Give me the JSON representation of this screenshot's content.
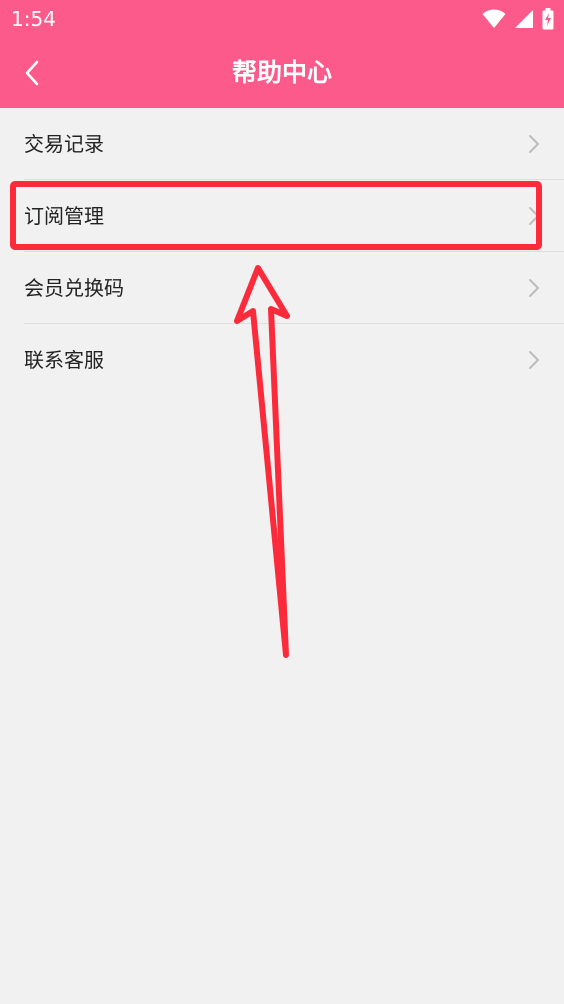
{
  "status_bar": {
    "time": "1:54",
    "icons": [
      "wifi-icon",
      "signal-icon",
      "battery-charging-icon"
    ]
  },
  "app_bar": {
    "back_icon": "back-chevron-icon",
    "title": "帮助中心"
  },
  "menu": {
    "items": [
      {
        "label": "交易记录",
        "icon": "chevron-right-icon"
      },
      {
        "label": "订阅管理",
        "icon": "chevron-right-icon"
      },
      {
        "label": "会员兑换码",
        "icon": "chevron-right-icon"
      },
      {
        "label": "联系客服",
        "icon": "chevron-right-icon"
      }
    ]
  },
  "annotation": {
    "highlighted_item": "订阅管理",
    "color": "#fb2b3b"
  },
  "colors": {
    "brand": "#fc5a8b",
    "background": "#f1f1f1",
    "text": "#222222",
    "chevron": "#bdbdbd"
  }
}
